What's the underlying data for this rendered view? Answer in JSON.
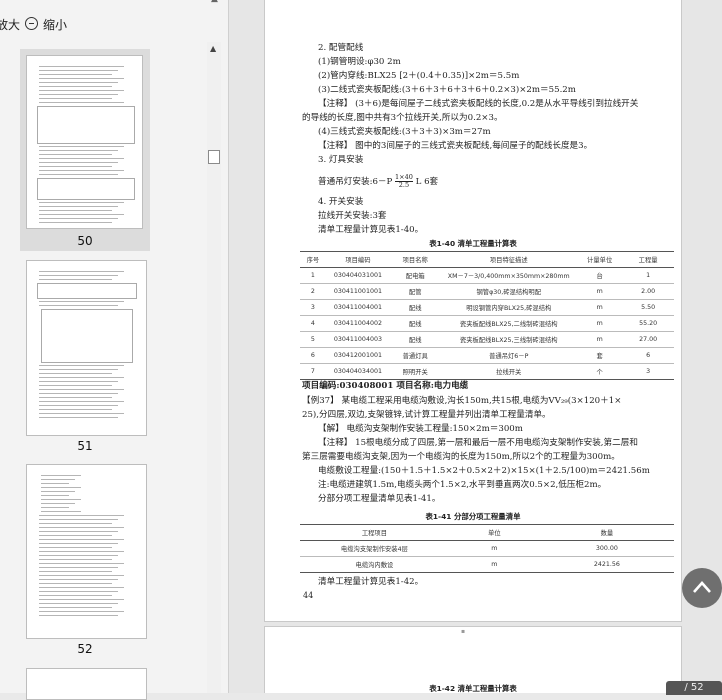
{
  "toolbar": {
    "zoom_in_label": "放大",
    "zoom_out_label": "缩小"
  },
  "thumbnails": [
    {
      "label": "50",
      "selected": true
    },
    {
      "label": "51",
      "selected": false
    },
    {
      "label": "52",
      "selected": false
    }
  ],
  "page": {
    "lines": [
      "2. 配管配线",
      "(1)钢管明设:φ30   2m",
      "(2)管内穿线:BLX25  [2＋(0.4＋0.35)]×2m＝5.5m",
      "(3)二线式瓷夹板配线:(3＋6＋3＋6＋3＋6＋0.2×3)×2m＝55.2m",
      "【注释】 (3＋6)是每间屋子二线式瓷夹板配线的长度,0.2是从水平导线引到拉线开关",
      "的导线的长度,图中共有3个拉线开关,所以为0.2×3。",
      "(4)三线式瓷夹板配线:(3＋3＋3)×3m＝27m",
      "【注释】 图中的3间屋子的三线式瓷夹板配线,每间屋子的配线长度是3。",
      "3. 灯具安装",
      "普通吊灯安装:6－P",
      "L  6套",
      "4. 开关安装",
      "拉线开关安装:3套",
      "清单工程量计算见表1-40。"
    ],
    "frac_num": "1×40",
    "frac_den": "2.5",
    "table1": {
      "caption": "表1-40  清单工程量计算表",
      "headers": [
        "序号",
        "项目编码",
        "项目名称",
        "项目特征描述",
        "计量单位",
        "工程量"
      ],
      "rows": [
        [
          "1",
          "030404031001",
          "配电箱",
          "XM－7－3/0,400mm×350mm×280mm",
          "台",
          "1"
        ],
        [
          "2",
          "030411001001",
          "配管",
          "钢管φ30,砖混结构明配",
          "m",
          "2.00"
        ],
        [
          "3",
          "030411004001",
          "配线",
          "明设钢管内穿BLX25,砖混结构",
          "m",
          "5.50"
        ],
        [
          "4",
          "030411004002",
          "配线",
          "瓷夹板配线BLX25,二线制砖混结构",
          "m",
          "55.20"
        ],
        [
          "5",
          "030411004003",
          "配线",
          "瓷夹板配线BLX25,三线制砖混结构",
          "m",
          "27.00"
        ],
        [
          "6",
          "030412001001",
          "普通灯具",
          "普通吊灯6－P",
          "套",
          "6"
        ],
        [
          "7",
          "030404034001",
          "照明开关",
          "拉线开关",
          "个",
          "3"
        ]
      ]
    },
    "section_head": "项目编码:030408001      项目名称:电力电缆",
    "example_lines": [
      "【例37】 某电缆工程采用电缆沟敷设,沟长150m,共15根,电缆为VV₂₉(3×120＋1×",
      "25),分四层,双边,支架镀锌,试计算工程量并列出清单工程量清单。",
      "【解】 电缆沟支架制作安装工程量:150×2m＝300m",
      "【注释】 15根电缆分成了四层,第一层和最后一层不用电缆沟支架制作安装,第二层和",
      "第三层需要电缆沟支架,因为一个电缆沟的长度为150m,所以2个的工程量为300m。",
      "电缆敷设工程量:(150＋1.5＋1.5×2＋0.5×2＋2)×15×(1＋2.5/100)m＝2421.56m",
      "注:电缆进建筑1.5m,电缆头两个1.5×2,水平到垂直两次0.5×2,低压柜2m。",
      "分部分项工程量清单见表1-41。"
    ],
    "table2": {
      "caption": "表1-41  分部分项工程量清单",
      "headers": [
        "工程项目",
        "单位",
        "数量"
      ],
      "rows": [
        [
          "电缆沟支架制作安装4层",
          "m",
          "300.00"
        ],
        [
          "电缆沟内敷设",
          "m",
          "2421.56"
        ]
      ]
    },
    "tail_line": "清单工程量计算见表1-42。",
    "page_number": "44"
  },
  "next_page_caption": "表1-42  清单工程量计算表",
  "page_indicator": "/ 52"
}
